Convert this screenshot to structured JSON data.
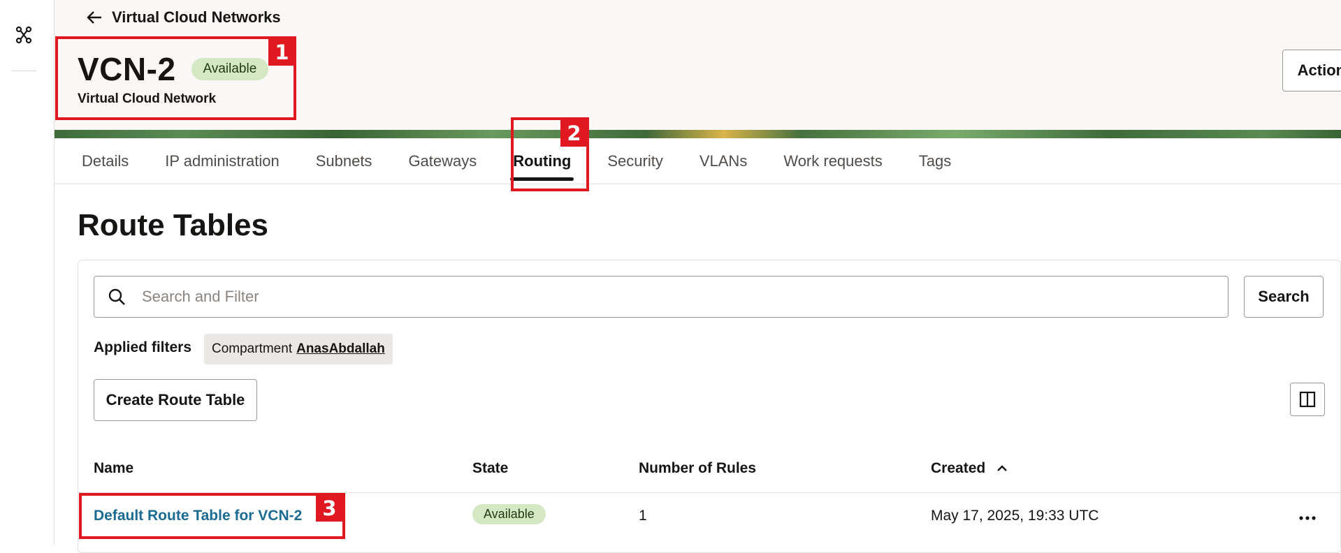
{
  "header": {
    "back_label": "Virtual Cloud Networks",
    "title": "VCN-2",
    "status": "Available",
    "subtitle": "Virtual Cloud Network",
    "actions_label": "Actions"
  },
  "annotations": [
    "1",
    "2",
    "3"
  ],
  "tabs": [
    {
      "label": "Details"
    },
    {
      "label": "IP administration"
    },
    {
      "label": "Subnets"
    },
    {
      "label": "Gateways"
    },
    {
      "label": "Routing",
      "active": true
    },
    {
      "label": "Security"
    },
    {
      "label": "VLANs"
    },
    {
      "label": "Work requests"
    },
    {
      "label": "Tags"
    }
  ],
  "section": {
    "title": "Route Tables"
  },
  "search": {
    "placeholder": "Search and Filter",
    "value": "",
    "button_label": "Search"
  },
  "filters": {
    "label": "Applied filters",
    "chip_key": "Compartment",
    "chip_value": "AnasAbdallah"
  },
  "toolbar": {
    "create_label": "Create Route Table"
  },
  "table": {
    "columns": [
      "Name",
      "State",
      "Number of Rules",
      "Created"
    ],
    "sort": {
      "column": "Created",
      "direction": "ascending"
    },
    "rows": [
      {
        "name": "Default Route Table for VCN-2",
        "state": "Available",
        "rules": "1",
        "created": "May 17, 2025, 19:33 UTC"
      }
    ]
  },
  "colors": {
    "accent_highlight": "#e0181f",
    "link": "#1b6a91",
    "badge_bg": "#d4e8c3",
    "header_bg": "#f9f8f6"
  },
  "icons": {
    "sidebar": "network-topology-icon",
    "back": "arrow-left-icon",
    "actions": "chevron-down-icon",
    "search": "search-icon",
    "columns": "columns-icon",
    "sort": "chevron-up-icon",
    "row_menu": "more-horizontal-icon"
  }
}
